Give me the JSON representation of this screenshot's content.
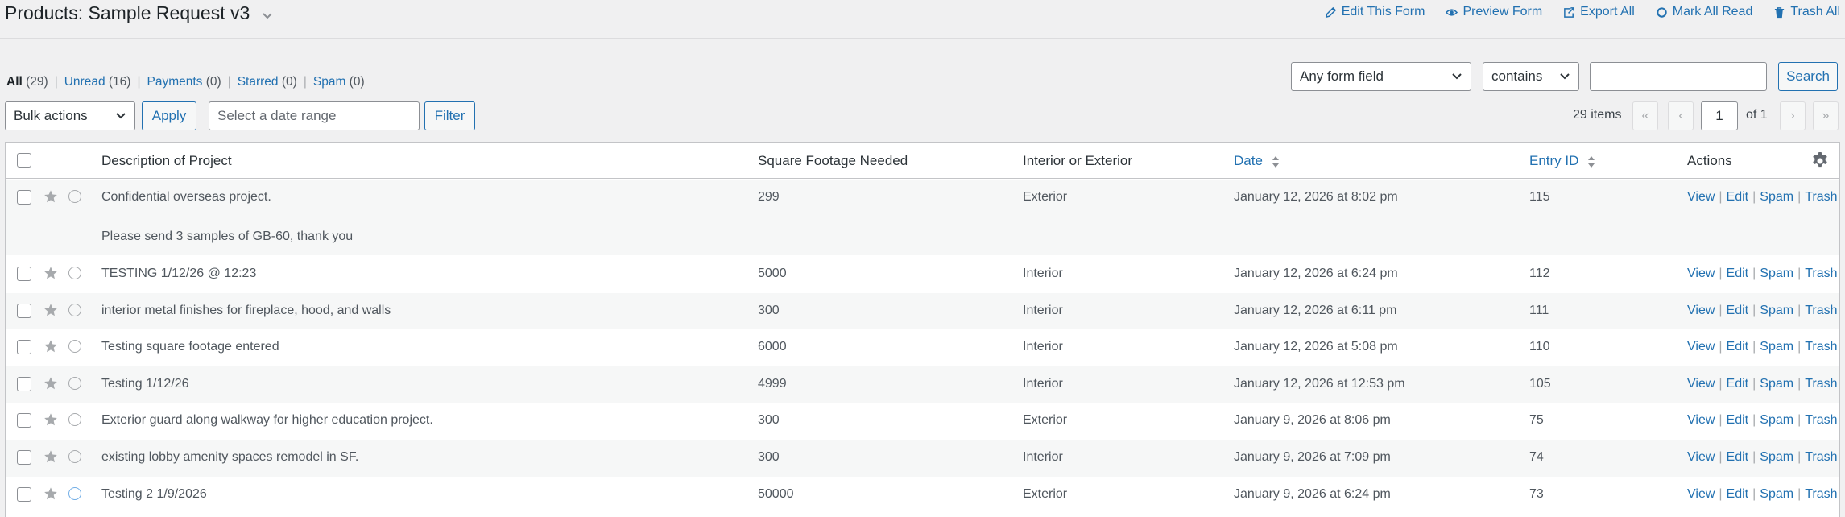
{
  "header": {
    "title": "Products: Sample Request v3",
    "actions": [
      {
        "label": "Edit This Form",
        "icon": "pencil-icon"
      },
      {
        "label": "Preview Form",
        "icon": "eye-icon"
      },
      {
        "label": "Export All",
        "icon": "export-icon"
      },
      {
        "label": "Mark All Read",
        "icon": "circle-icon"
      },
      {
        "label": "Trash All",
        "icon": "trash-icon"
      }
    ]
  },
  "views": [
    {
      "label": "All",
      "count": "(29)"
    },
    {
      "label": "Unread",
      "count": "(16)"
    },
    {
      "label": "Payments",
      "count": "(0)"
    },
    {
      "label": "Starred",
      "count": "(0)"
    },
    {
      "label": "Spam",
      "count": "(0)"
    }
  ],
  "search": {
    "field": "Any form field",
    "operator": "contains",
    "value": "",
    "button": "Search"
  },
  "bulk": {
    "action": "Bulk actions",
    "apply": "Apply",
    "date_placeholder": "Select a date range",
    "filter": "Filter"
  },
  "pagination": {
    "items": "29 items",
    "current_page": "1",
    "of": "of 1",
    "first": "«",
    "prev": "‹",
    "next": "›",
    "last": "»"
  },
  "columns": {
    "description": "Description of Project",
    "sqft": "Square Footage Needed",
    "location": "Interior or Exterior",
    "date": "Date",
    "entry_id": "Entry ID",
    "actions": "Actions"
  },
  "row_actions": {
    "view": "View",
    "edit": "Edit",
    "spam": "Spam",
    "trash": "Trash"
  },
  "rows": [
    {
      "description": "Confidential overseas project.",
      "note": "Please send 3 samples of GB-60, thank you",
      "sqft": "299",
      "location": "Exterior",
      "date": "January 12, 2026 at 8:02 pm",
      "id": "115"
    },
    {
      "description": "TESTING 1/12/26 @ 12:23",
      "sqft": "5000",
      "location": "Interior",
      "date": "January 12, 2026 at 6:24 pm",
      "id": "112"
    },
    {
      "description": "interior metal finishes for fireplace, hood, and walls",
      "sqft": "300",
      "location": "Interior",
      "date": "January 12, 2026 at 6:11 pm",
      "id": "111"
    },
    {
      "description": "Testing square footage entered",
      "sqft": "6000",
      "location": "Interior",
      "date": "January 12, 2026 at 5:08 pm",
      "id": "110"
    },
    {
      "description": "Testing 1/12/26",
      "sqft": "4999",
      "location": "Interior",
      "date": "January 12, 2026 at 12:53 pm",
      "id": "105"
    },
    {
      "description": "Exterior guard along walkway for higher education project.",
      "sqft": "300",
      "location": "Exterior",
      "date": "January 9, 2026 at 8:06 pm",
      "id": "75"
    },
    {
      "description": "existing lobby amenity spaces remodel in SF.",
      "sqft": "300",
      "location": "Interior",
      "date": "January 9, 2026 at 7:09 pm",
      "id": "74"
    },
    {
      "description": "Testing 2 1/9/2026",
      "sqft": "50000",
      "location": "Exterior",
      "date": "January 9, 2026 at 6:24 pm",
      "id": "73"
    }
  ],
  "colors": {
    "link": "#2271b1",
    "border": "#c3c4c7",
    "background": "#f0f0f1"
  }
}
